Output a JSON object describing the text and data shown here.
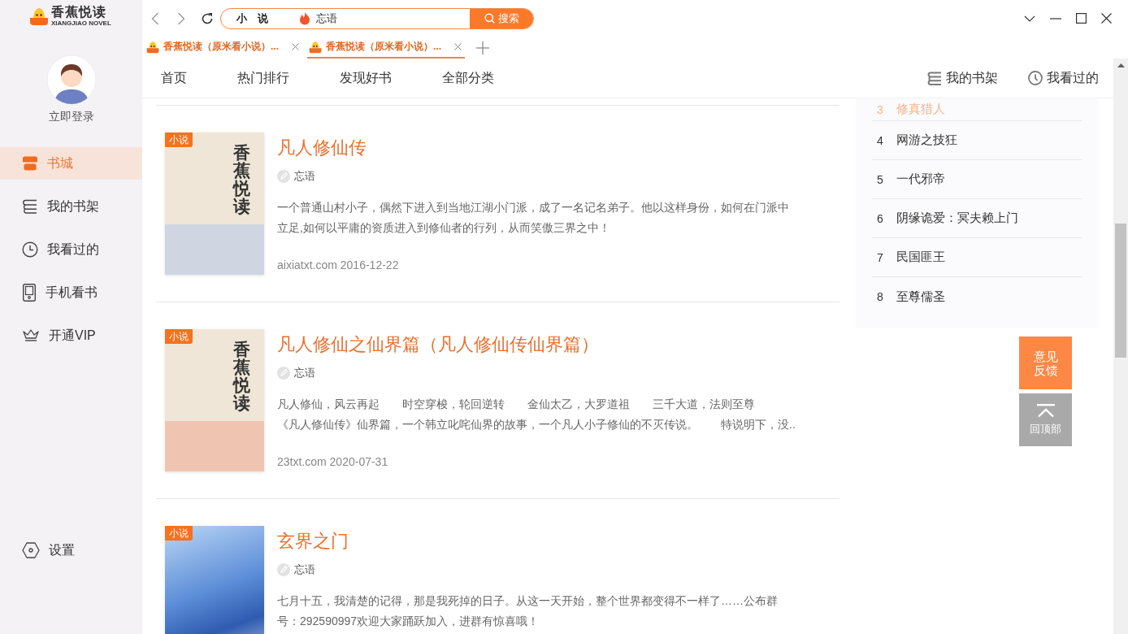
{
  "app": {
    "logo_title": "香蕉悦读",
    "logo_subtitle": "XIANGJIAO NOVEL"
  },
  "sidebar": {
    "login": "立即登录",
    "items": [
      {
        "label": "书城",
        "selected": true
      },
      {
        "label": "我的书架",
        "selected": false
      },
      {
        "label": "我看过的",
        "selected": false
      },
      {
        "label": "手机看书",
        "selected": false
      },
      {
        "label": "开通VIP",
        "selected": false
      }
    ],
    "settings": "设置"
  },
  "browser": {
    "search": {
      "category": "小　说",
      "value": "忘语",
      "button": "搜索"
    },
    "tabs": [
      {
        "title": "香蕉悦读（原米看小说）...",
        "selected": false
      },
      {
        "title": "香蕉悦读（原米看小说）...",
        "selected": true
      }
    ]
  },
  "nav": {
    "items": [
      {
        "label": "首页",
        "selected": false
      },
      {
        "label": "热门排行",
        "selected": false
      },
      {
        "label": "发现好书",
        "selected": false
      },
      {
        "label": "全部分类",
        "selected": false
      }
    ],
    "links": [
      "我的书架",
      "我看过的"
    ]
  },
  "books": [
    {
      "tag": "小说",
      "title": "凡人修仙传",
      "author": "忘语",
      "description": [
        "一个普通山村小子，偶然下进入到当地江湖小门派，成了一名记名弟子。他以这样身份，如何在门派中",
        "立足,如何以平庸的资质进入到修仙者的行列，从而笑傲三界之中！"
      ],
      "meta": "aixiatxt.com 2016-12-22",
      "cover": {
        "kind": "placeholder",
        "text": "香蕉悦读",
        "color": "#d0d6e1"
      }
    },
    {
      "tag": "小说",
      "title": "凡人修仙之仙界篇（凡人修仙传仙界篇）",
      "author": "忘语",
      "description": [
        "凡人修仙，风云再起　　时空穿梭，轮回逆转　　金仙太乙，大罗道祖　　三千大道，法则至尊",
        "《凡人修仙传》仙界篇，一个韩立叱咤仙界的故事，一个凡人小子修仙的不灭传说。　　特说明下，没.."
      ],
      "meta": "23txt.com 2020-07-31",
      "cover": {
        "kind": "placeholder",
        "text": "香蕉悦读",
        "color": "#efc5b1"
      }
    },
    {
      "tag": "小说",
      "title": "玄界之门",
      "author": "忘语",
      "description": [
        "七月十五，我清楚的记得，那是我死掉的日子。从这一天开始，整个世界都变得不一样了……公布群",
        "号：292590997欢迎大家踊跃加入，进群有惊喜哦！"
      ],
      "cover": {
        "kind": "photo"
      }
    }
  ],
  "ranking": [
    {
      "rank": "3",
      "title": "修真猎人",
      "highlighted": true
    },
    {
      "rank": "4",
      "title": "网游之技狂",
      "highlighted": false
    },
    {
      "rank": "5",
      "title": "一代邪帝",
      "highlighted": false
    },
    {
      "rank": "6",
      "title": "阴缘诡爱：冥夫赖上门",
      "highlighted": false
    },
    {
      "rank": "7",
      "title": "民国匪王",
      "highlighted": false
    },
    {
      "rank": "8",
      "title": "至尊儒圣",
      "highlighted": false
    }
  ],
  "float_buttons": [
    {
      "kind": "feedback",
      "label": "意见反馈"
    },
    {
      "kind": "back_to_top",
      "label": "回顶部"
    }
  ]
}
